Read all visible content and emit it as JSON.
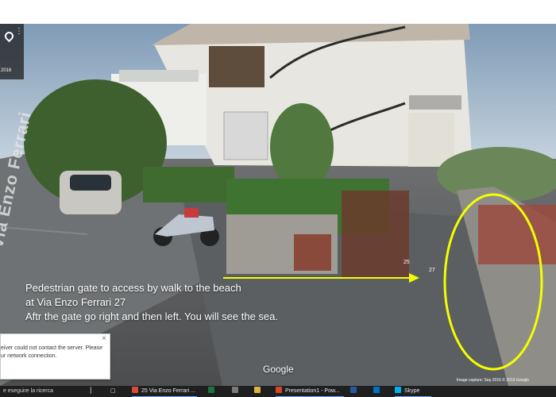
{
  "viewer": {
    "top_left": {
      "pin_icon": "map-pin",
      "menu_icon": "vertical-dots",
      "year": "2016"
    },
    "street_sign": "Via Enzo Ferrari",
    "house_numbers": [
      "25",
      "27"
    ],
    "annotation": {
      "line1": "Pedestrian gate to access by walk to the beach",
      "line2": "at Via Enzo Ferrari 27",
      "line3": "Aftr the gate go right and then left. You will see the sea."
    },
    "google_logo": "Google",
    "capture_text": "Image capture: Sep 2016     © 2019 Google",
    "error_message": {
      "line1": "eiver could not contact the server.  Please",
      "line2": "ur network connection."
    },
    "colors": {
      "annotation_arrow": "#f2ff00",
      "annotation_circle": "#f2ff00"
    }
  },
  "taskbar": {
    "search_placeholder": "e eseguire la ricerca",
    "apps": [
      {
        "name": "chrome",
        "label": "25 Via Enzo Ferrari ...",
        "color": "#d94a38"
      },
      {
        "name": "excel",
        "label": "",
        "color": "#1e7145"
      },
      {
        "name": "calculator",
        "label": "",
        "color": "#7a7a7a"
      },
      {
        "name": "file-explorer",
        "label": "",
        "color": "#d9b343"
      },
      {
        "name": "powerpoint",
        "label": "Presentation1 - Pow...",
        "color": "#d24726"
      },
      {
        "name": "word",
        "label": "",
        "color": "#2b579a"
      },
      {
        "name": "outlook",
        "label": "",
        "color": "#0072c6"
      },
      {
        "name": "skype",
        "label": "Skype",
        "color": "#00aff0"
      }
    ]
  }
}
